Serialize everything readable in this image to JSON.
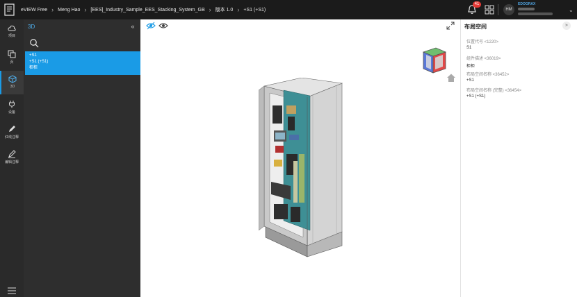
{
  "topbar": {
    "app_name": "eVIEW Free",
    "breadcrumb": [
      "Meng Hao",
      "[EES]_Industry_Sample_EES_Stacking_System_GB",
      "版本 1.0",
      "+S1 (+S1)"
    ],
    "notification_count": "41",
    "avatar_initials": "HM",
    "brand": "EDOGRAX"
  },
  "rail": {
    "items": [
      {
        "label": "项目",
        "icon": "cloud-icon"
      },
      {
        "label": "页",
        "icon": "pages-icon"
      },
      {
        "label": "3D",
        "icon": "cube-icon",
        "active": true
      },
      {
        "label": "设备",
        "icon": "plug-icon"
      },
      {
        "label": "红线注释",
        "icon": "redline-pen-icon"
      },
      {
        "label": "编辑注释",
        "icon": "edit-pen-icon"
      }
    ]
  },
  "panel": {
    "title": "3D",
    "selected_item": {
      "line1": "+S1",
      "line2": "+S1 (+S1)",
      "line3": "柜柜"
    }
  },
  "right_panel": {
    "title": "布局空间",
    "properties": [
      {
        "key": "位置代号 <1220>",
        "value": "S1"
      },
      {
        "key": "组件描述 <36019>",
        "value": "柜柜"
      },
      {
        "key": "布局空间名称 <36452>",
        "value": "+S1"
      },
      {
        "key": "布局空间名称 (完整) <36454>",
        "value": "+S1 (+S1)"
      }
    ]
  },
  "colors": {
    "accent": "#1a9be6",
    "topbar": "#1b1b1b",
    "sidebar": "#2e2e2e",
    "badge": "#e53935"
  }
}
